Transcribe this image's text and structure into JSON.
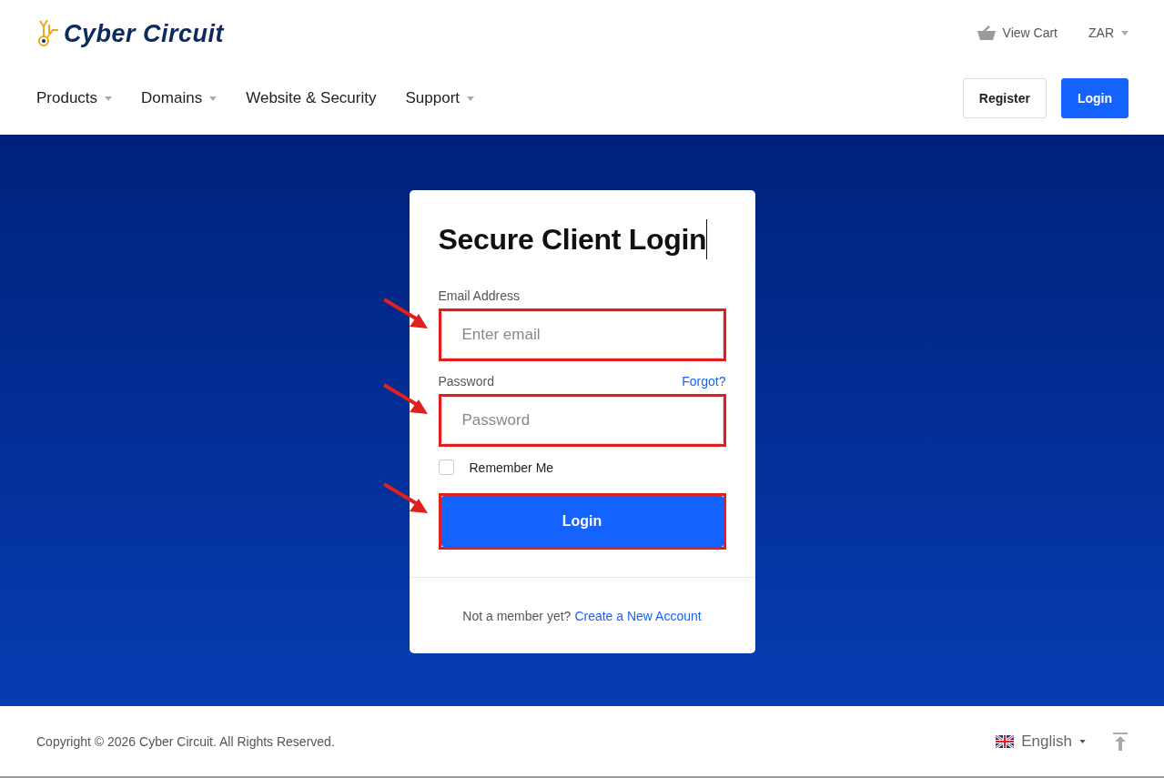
{
  "header": {
    "logo": "Cyber Circuit",
    "cart": "View Cart",
    "currency": "ZAR",
    "nav": [
      {
        "label": "Products",
        "dropdown": true
      },
      {
        "label": "Domains",
        "dropdown": true
      },
      {
        "label": "Website & Security",
        "dropdown": false
      },
      {
        "label": "Support",
        "dropdown": true
      }
    ],
    "register": "Register",
    "login": "Login"
  },
  "login_card": {
    "title": "Secure Client Login",
    "email": {
      "label": "Email Address",
      "placeholder": "Enter email",
      "highlighted": true
    },
    "password": {
      "label": "Password",
      "forgot": "Forgot?",
      "placeholder": "Password",
      "highlighted": true
    },
    "remember": {
      "label": "Remember Me",
      "checked": false
    },
    "submit": {
      "label": "Login",
      "highlighted": true
    },
    "footer_text": "Not a member yet?",
    "footer_link": "Create a New Account"
  },
  "footer": {
    "copyright": "Copyright © 2026 Cyber Circuit. All Rights Reserved.",
    "language": "English"
  }
}
